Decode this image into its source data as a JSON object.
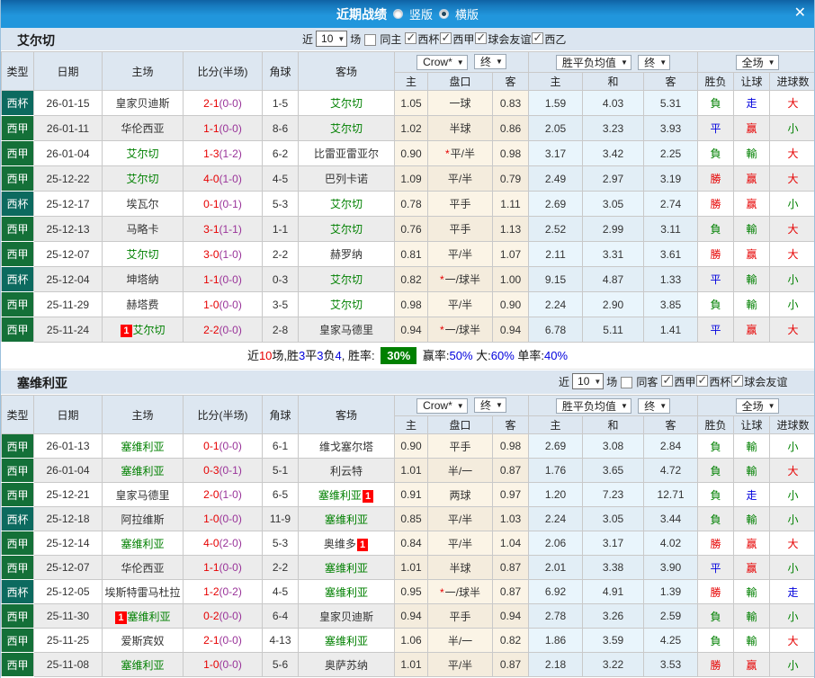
{
  "titlebar": {
    "title": "近期战绩",
    "radio_vertical": "竖版",
    "radio_horizontal": "横版",
    "close": "✕"
  },
  "badge_label": "1",
  "colors": {
    "titlebar_blue": "#2196dc",
    "league_green": "#147038",
    "cup_teal": "#0c6a5f",
    "win_red": "#e60000",
    "draw_blue": "#0000dd",
    "lose_green": "#008000",
    "score_red": "#e60000",
    "half_purple": "#993399",
    "odds_bg": "#fbf4e6",
    "avg_bg": "#e9f5fc",
    "summary_badge_green": "#008000"
  },
  "table_head": {
    "type": "类型",
    "date": "日期",
    "home": "主场",
    "score": "比分(半场)",
    "corner": "角球",
    "away": "客场",
    "dd_odds": "Crow*",
    "dd_fin1": "终",
    "dd_avg": "胜平负均值",
    "dd_fin2": "终",
    "dd_scope": "全场",
    "sub_home": "主",
    "sub_pankou": "盘口",
    "sub_away": "客",
    "sub_h": "主",
    "sub_d": "和",
    "sub_a": "客",
    "sub_wdl": "胜负",
    "sub_let": "让球",
    "sub_goal": "进球数"
  },
  "sections": [
    {
      "team": "艾尔切",
      "filter": {
        "near": "近",
        "count": "10",
        "unit": "场",
        "same": "同主",
        "same_checked": false,
        "leagues": [
          "西杯",
          "西甲",
          "球会友谊",
          "西乙"
        ]
      },
      "rows": [
        {
          "t": "西杯",
          "k": "cup",
          "d": "26-01-15",
          "h": [
            "皇家贝迪斯",
            0,
            0
          ],
          "s": "2-1",
          "hf": "(0-0)",
          "c": "1-5",
          "a": [
            "艾尔切",
            1,
            0
          ],
          "o": [
            "1.05",
            "一球",
            "0.83"
          ],
          "st": 0,
          "v": [
            "1.59",
            "4.03",
            "5.31"
          ],
          "r": [
            "負",
            "g"
          ],
          "l": [
            "走",
            "b"
          ],
          "g": [
            "大",
            "r"
          ]
        },
        {
          "t": "西甲",
          "k": "lg",
          "d": "26-01-11",
          "h": [
            "华伦西亚",
            0,
            0
          ],
          "s": "1-1",
          "hf": "(0-0)",
          "c": "8-6",
          "a": [
            "艾尔切",
            1,
            0
          ],
          "o": [
            "1.02",
            "半球",
            "0.86"
          ],
          "st": 0,
          "v": [
            "2.05",
            "3.23",
            "3.93"
          ],
          "r": [
            "平",
            "b"
          ],
          "l": [
            "赢",
            "r"
          ],
          "g": [
            "小",
            "g"
          ]
        },
        {
          "t": "西甲",
          "k": "lg",
          "d": "26-01-04",
          "h": [
            "艾尔切",
            1,
            0
          ],
          "s": "1-3",
          "hf": "(1-2)",
          "c": "6-2",
          "a": [
            "比雷亚雷亚尔",
            0,
            0
          ],
          "o": [
            "0.90",
            "平/半",
            "0.98"
          ],
          "st": 1,
          "v": [
            "3.17",
            "3.42",
            "2.25"
          ],
          "r": [
            "負",
            "g"
          ],
          "l": [
            "輸",
            "g"
          ],
          "g": [
            "大",
            "r"
          ]
        },
        {
          "t": "西甲",
          "k": "lg",
          "d": "25-12-22",
          "h": [
            "艾尔切",
            1,
            0
          ],
          "s": "4-0",
          "hf": "(1-0)",
          "c": "4-5",
          "a": [
            "巴列卡诺",
            0,
            0
          ],
          "o": [
            "1.09",
            "平/半",
            "0.79"
          ],
          "st": 0,
          "v": [
            "2.49",
            "2.97",
            "3.19"
          ],
          "r": [
            "勝",
            "r"
          ],
          "l": [
            "赢",
            "r"
          ],
          "g": [
            "大",
            "r"
          ]
        },
        {
          "t": "西杯",
          "k": "cup",
          "d": "25-12-17",
          "h": [
            "埃瓦尔",
            0,
            0
          ],
          "s": "0-1",
          "hf": "(0-1)",
          "c": "5-3",
          "a": [
            "艾尔切",
            1,
            0
          ],
          "o": [
            "0.78",
            "平手",
            "1.11"
          ],
          "st": 0,
          "v": [
            "2.69",
            "3.05",
            "2.74"
          ],
          "r": [
            "勝",
            "r"
          ],
          "l": [
            "赢",
            "r"
          ],
          "g": [
            "小",
            "g"
          ]
        },
        {
          "t": "西甲",
          "k": "lg",
          "d": "25-12-13",
          "h": [
            "马略卡",
            0,
            0
          ],
          "s": "3-1",
          "hf": "(1-1)",
          "c": "1-1",
          "a": [
            "艾尔切",
            1,
            0
          ],
          "o": [
            "0.76",
            "平手",
            "1.13"
          ],
          "st": 0,
          "v": [
            "2.52",
            "2.99",
            "3.11"
          ],
          "r": [
            "負",
            "g"
          ],
          "l": [
            "輸",
            "g"
          ],
          "g": [
            "大",
            "r"
          ]
        },
        {
          "t": "西甲",
          "k": "lg",
          "d": "25-12-07",
          "h": [
            "艾尔切",
            1,
            0
          ],
          "s": "3-0",
          "hf": "(1-0)",
          "c": "2-2",
          "a": [
            "赫罗纳",
            0,
            0
          ],
          "o": [
            "0.81",
            "平/半",
            "1.07"
          ],
          "st": 0,
          "v": [
            "2.11",
            "3.31",
            "3.61"
          ],
          "r": [
            "勝",
            "r"
          ],
          "l": [
            "赢",
            "r"
          ],
          "g": [
            "大",
            "r"
          ]
        },
        {
          "t": "西杯",
          "k": "cup",
          "d": "25-12-04",
          "h": [
            "坤塔纳",
            0,
            0
          ],
          "s": "1-1",
          "hf": "(0-0)",
          "c": "0-3",
          "a": [
            "艾尔切",
            1,
            0
          ],
          "o": [
            "0.82",
            "一/球半",
            "1.00"
          ],
          "st": 1,
          "v": [
            "9.15",
            "4.87",
            "1.33"
          ],
          "r": [
            "平",
            "b"
          ],
          "l": [
            "輸",
            "g"
          ],
          "g": [
            "小",
            "g"
          ]
        },
        {
          "t": "西甲",
          "k": "lg",
          "d": "25-11-29",
          "h": [
            "赫塔费",
            0,
            0
          ],
          "s": "1-0",
          "hf": "(0-0)",
          "c": "3-5",
          "a": [
            "艾尔切",
            1,
            0
          ],
          "o": [
            "0.98",
            "平/半",
            "0.90"
          ],
          "st": 0,
          "v": [
            "2.24",
            "2.90",
            "3.85"
          ],
          "r": [
            "負",
            "g"
          ],
          "l": [
            "輸",
            "g"
          ],
          "g": [
            "小",
            "g"
          ]
        },
        {
          "t": "西甲",
          "k": "lg",
          "d": "25-11-24",
          "h": [
            "艾尔切",
            1,
            1
          ],
          "s": "2-2",
          "hf": "(0-0)",
          "c": "2-8",
          "a": [
            "皇家马德里",
            0,
            0
          ],
          "o": [
            "0.94",
            "一/球半",
            "0.94"
          ],
          "st": 1,
          "v": [
            "6.78",
            "5.11",
            "1.41"
          ],
          "r": [
            "平",
            "b"
          ],
          "l": [
            "赢",
            "r"
          ],
          "g": [
            "大",
            "r"
          ]
        }
      ],
      "summary": [
        [
          "近",
          "k"
        ],
        [
          "10",
          "r"
        ],
        [
          "场,胜",
          "k"
        ],
        [
          "3",
          "b"
        ],
        [
          "平",
          "k"
        ],
        [
          "3",
          "b"
        ],
        [
          "负",
          "k"
        ],
        [
          "4",
          "b"
        ],
        [
          ", 胜率: ",
          "k"
        ],
        [
          "30%",
          "badge"
        ],
        [
          " 赢率:",
          "k"
        ],
        [
          "50%",
          "b"
        ],
        [
          " 大:",
          "k"
        ],
        [
          "60%",
          "b"
        ],
        [
          " 单率:",
          "k"
        ],
        [
          "40%",
          "b"
        ]
      ]
    },
    {
      "team": "塞维利亚",
      "filter": {
        "near": "近",
        "count": "10",
        "unit": "场",
        "same": "同客",
        "same_checked": false,
        "leagues": [
          "西甲",
          "西杯",
          "球会友谊"
        ]
      },
      "rows": [
        {
          "t": "西甲",
          "k": "lg",
          "d": "26-01-13",
          "h": [
            "塞维利亚",
            1,
            0
          ],
          "s": "0-1",
          "hf": "(0-0)",
          "c": "6-1",
          "a": [
            "维戈塞尔塔",
            0,
            0
          ],
          "o": [
            "0.90",
            "平手",
            "0.98"
          ],
          "st": 0,
          "v": [
            "2.69",
            "3.08",
            "2.84"
          ],
          "r": [
            "負",
            "g"
          ],
          "l": [
            "輸",
            "g"
          ],
          "g": [
            "小",
            "g"
          ]
        },
        {
          "t": "西甲",
          "k": "lg",
          "d": "26-01-04",
          "h": [
            "塞维利亚",
            1,
            0
          ],
          "s": "0-3",
          "hf": "(0-1)",
          "c": "5-1",
          "a": [
            "利云特",
            0,
            0
          ],
          "o": [
            "1.01",
            "半/一",
            "0.87"
          ],
          "st": 0,
          "v": [
            "1.76",
            "3.65",
            "4.72"
          ],
          "r": [
            "負",
            "g"
          ],
          "l": [
            "輸",
            "g"
          ],
          "g": [
            "大",
            "r"
          ]
        },
        {
          "t": "西甲",
          "k": "lg",
          "d": "25-12-21",
          "h": [
            "皇家马德里",
            0,
            0
          ],
          "s": "2-0",
          "hf": "(1-0)",
          "c": "6-5",
          "a": [
            "塞维利亚",
            1,
            2
          ],
          "o": [
            "0.91",
            "两球",
            "0.97"
          ],
          "st": 0,
          "v": [
            "1.20",
            "7.23",
            "12.71"
          ],
          "r": [
            "負",
            "g"
          ],
          "l": [
            "走",
            "b"
          ],
          "g": [
            "小",
            "g"
          ]
        },
        {
          "t": "西杯",
          "k": "cup",
          "d": "25-12-18",
          "h": [
            "阿拉维斯",
            0,
            0
          ],
          "s": "1-0",
          "hf": "(0-0)",
          "c": "11-9",
          "a": [
            "塞维利亚",
            1,
            0
          ],
          "o": [
            "0.85",
            "平/半",
            "1.03"
          ],
          "st": 0,
          "v": [
            "2.24",
            "3.05",
            "3.44"
          ],
          "r": [
            "負",
            "g"
          ],
          "l": [
            "輸",
            "g"
          ],
          "g": [
            "小",
            "g"
          ]
        },
        {
          "t": "西甲",
          "k": "lg",
          "d": "25-12-14",
          "h": [
            "塞维利亚",
            1,
            0
          ],
          "s": "4-0",
          "hf": "(2-0)",
          "c": "5-3",
          "a": [
            "奥维多",
            0,
            2
          ],
          "o": [
            "0.84",
            "平/半",
            "1.04"
          ],
          "st": 0,
          "v": [
            "2.06",
            "3.17",
            "4.02"
          ],
          "r": [
            "勝",
            "r"
          ],
          "l": [
            "赢",
            "r"
          ],
          "g": [
            "大",
            "r"
          ]
        },
        {
          "t": "西甲",
          "k": "lg",
          "d": "25-12-07",
          "h": [
            "华伦西亚",
            0,
            0
          ],
          "s": "1-1",
          "hf": "(0-0)",
          "c": "2-2",
          "a": [
            "塞维利亚",
            1,
            0
          ],
          "o": [
            "1.01",
            "半球",
            "0.87"
          ],
          "st": 0,
          "v": [
            "2.01",
            "3.38",
            "3.90"
          ],
          "r": [
            "平",
            "b"
          ],
          "l": [
            "赢",
            "r"
          ],
          "g": [
            "小",
            "g"
          ]
        },
        {
          "t": "西杯",
          "k": "cup",
          "d": "25-12-05",
          "h": [
            "埃斯特雷马杜拉",
            0,
            0
          ],
          "s": "1-2",
          "hf": "(0-2)",
          "c": "4-5",
          "a": [
            "塞维利亚",
            1,
            0
          ],
          "o": [
            "0.95",
            "一/球半",
            "0.87"
          ],
          "st": 1,
          "v": [
            "6.92",
            "4.91",
            "1.39"
          ],
          "r": [
            "勝",
            "r"
          ],
          "l": [
            "輸",
            "g"
          ],
          "g": [
            "走",
            "b"
          ]
        },
        {
          "t": "西甲",
          "k": "lg",
          "d": "25-11-30",
          "h": [
            "塞维利亚",
            1,
            1
          ],
          "s": "0-2",
          "hf": "(0-0)",
          "c": "6-4",
          "a": [
            "皇家贝迪斯",
            0,
            0
          ],
          "o": [
            "0.94",
            "平手",
            "0.94"
          ],
          "st": 0,
          "v": [
            "2.78",
            "3.26",
            "2.59"
          ],
          "r": [
            "負",
            "g"
          ],
          "l": [
            "輸",
            "g"
          ],
          "g": [
            "小",
            "g"
          ]
        },
        {
          "t": "西甲",
          "k": "lg",
          "d": "25-11-25",
          "h": [
            "爱斯宾奴",
            0,
            0
          ],
          "s": "2-1",
          "hf": "(0-0)",
          "c": "4-13",
          "a": [
            "塞维利亚",
            1,
            0
          ],
          "o": [
            "1.06",
            "半/一",
            "0.82"
          ],
          "st": 0,
          "v": [
            "1.86",
            "3.59",
            "4.25"
          ],
          "r": [
            "負",
            "g"
          ],
          "l": [
            "輸",
            "g"
          ],
          "g": [
            "大",
            "r"
          ]
        },
        {
          "t": "西甲",
          "k": "lg",
          "d": "25-11-08",
          "h": [
            "塞维利亚",
            1,
            0
          ],
          "s": "1-0",
          "hf": "(0-0)",
          "c": "5-6",
          "a": [
            "奥萨苏纳",
            0,
            0
          ],
          "o": [
            "1.01",
            "平/半",
            "0.87"
          ],
          "st": 0,
          "v": [
            "2.18",
            "3.22",
            "3.53"
          ],
          "r": [
            "勝",
            "r"
          ],
          "l": [
            "赢",
            "r"
          ],
          "g": [
            "小",
            "g"
          ]
        }
      ],
      "summary": null
    }
  ]
}
